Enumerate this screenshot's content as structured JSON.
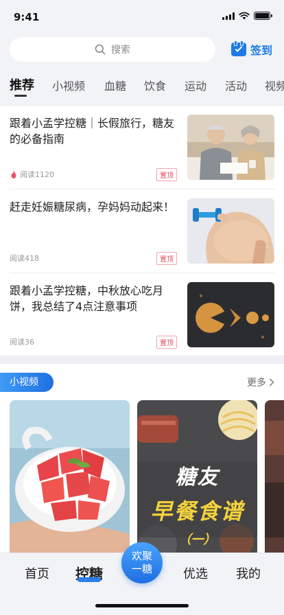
{
  "status": {
    "time": "9:41"
  },
  "header": {
    "search_placeholder": "搜索",
    "checkin_label": "签到"
  },
  "tabs": [
    "推荐",
    "小视频",
    "血糖",
    "饮食",
    "运动",
    "活动",
    "视频"
  ],
  "articles": [
    {
      "title": "跟着小孟学控糖｜长假旅行，糖友的必备指南",
      "reads": "阅读1120",
      "badge": "置顶",
      "hot": true
    },
    {
      "title": "赶走妊娠糖尿病，孕妈妈动起来！",
      "reads": "阅读418",
      "badge": "置顶",
      "hot": false
    },
    {
      "title": "跟着小孟学控糖，中秋放心吃月饼，我总结了4点注意事项",
      "reads": "阅读36",
      "badge": "置顶",
      "hot": false
    }
  ],
  "videos": {
    "section_label": "小视频",
    "more_label": "更多",
    "card2_text": {
      "line1": "糖友",
      "line2": "早餐食谱",
      "line3": "（一）"
    }
  },
  "tabbar": {
    "items": [
      "首页",
      "控糖",
      "优选",
      "我的"
    ],
    "center": {
      "line1": "欢聚",
      "line2": "一糖"
    }
  },
  "colors": {
    "accent": "#1f7be6",
    "badge": "#e24a5c"
  }
}
